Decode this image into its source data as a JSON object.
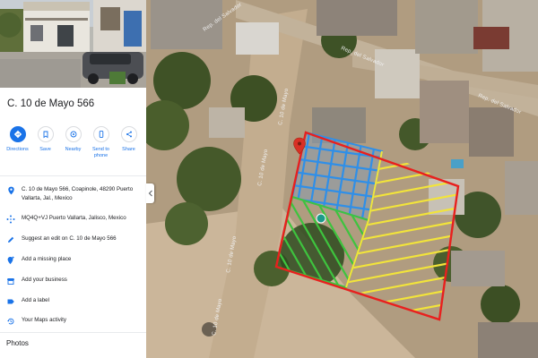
{
  "place": {
    "title": "C. 10 de Mayo 566"
  },
  "actions": [
    {
      "label": "Directions",
      "icon": "directions-icon"
    },
    {
      "label": "Save",
      "icon": "bookmark-icon"
    },
    {
      "label": "Nearby",
      "icon": "nearby-icon"
    },
    {
      "label": "Send to\nphone",
      "icon": "phone-icon"
    },
    {
      "label": "Share",
      "icon": "share-icon"
    }
  ],
  "info": {
    "address": "C. 10 de Mayo 566, Coapinole, 48290 Puerto Vallarta, Jal., Mexico",
    "plus_code": "MQ4Q+VJ Puerto Vallarta, Jalisco, Mexico",
    "suggest_edit": "Suggest an edit on C. 10 de Mayo 566",
    "add_missing": "Add a missing place",
    "add_business": "Add your business",
    "add_label": "Add a label",
    "maps_activity": "Your Maps activity"
  },
  "photos_heading": "Photos",
  "map": {
    "street_labels": [
      "Rep. del Salvador",
      "Rep. del Salvador",
      "Rep. del Salvador",
      "C. 10 de Mayo",
      "C. 10 de Mayo",
      "C. 10 de Mayo",
      "C. 10 de Mayo"
    ]
  },
  "colors": {
    "accent": "#1a73e8",
    "icon_gray": "#5f6368",
    "hatch_blue": "#2f8fe8",
    "hatch_yellow": "#f2e43a",
    "hatch_green": "#3ec43e",
    "outline_red": "#e8201e",
    "pin_red": "#d93025"
  }
}
